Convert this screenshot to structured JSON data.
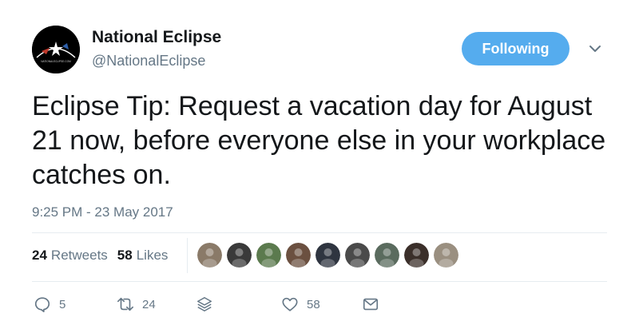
{
  "user": {
    "name": "National Eclipse",
    "handle": "@NationalEclipse",
    "avatar_caption": "NATIONALECLIPSE.COM"
  },
  "follow_button": {
    "label": "Following",
    "color": "#55acee"
  },
  "tweet": {
    "text": "Eclipse Tip: Request a vacation day for August 21 now, before everyone else in your workplace catches on.",
    "timestamp": "9:25 PM - 23 May 2017"
  },
  "stats": {
    "retweets_count": "24",
    "retweets_label": "Retweets",
    "likes_count": "58",
    "likes_label": "Likes"
  },
  "likers": [
    {
      "color": "#8a7a68"
    },
    {
      "color": "#3a3a3a"
    },
    {
      "color": "#5b7a4e"
    },
    {
      "color": "#6b5040"
    },
    {
      "color": "#2f3540"
    },
    {
      "color": "#4a4a4a"
    },
    {
      "color": "#5a6b5e"
    },
    {
      "color": "#3b2f2a"
    },
    {
      "color": "#9a8f80"
    }
  ],
  "actions": {
    "reply": {
      "icon": "reply-icon",
      "count": "5"
    },
    "retweet": {
      "icon": "retweet-icon",
      "count": "24"
    },
    "stack": {
      "icon": "stack-icon"
    },
    "like": {
      "icon": "heart-icon",
      "count": "58"
    },
    "message": {
      "icon": "envelope-icon"
    }
  },
  "colors": {
    "accent": "#55acee",
    "muted": "#657786",
    "text": "#14171a"
  }
}
